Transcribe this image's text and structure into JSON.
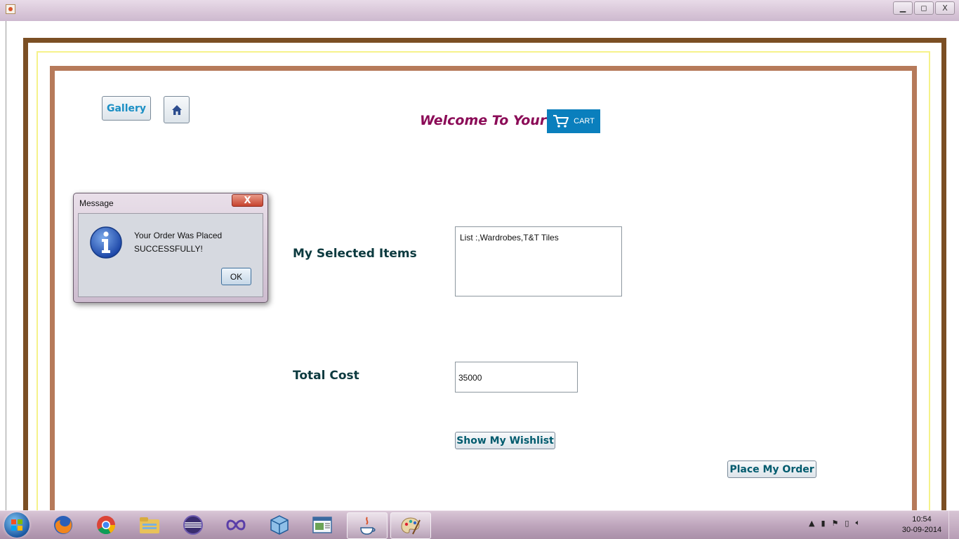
{
  "window": {
    "minimize": "▁",
    "maximize": "◻",
    "close": "X"
  },
  "toolbar": {
    "gallery_label": "Gallery",
    "home_icon": "home-icon"
  },
  "header": {
    "welcome": "Welcome To Your",
    "cart_label": "CART"
  },
  "form": {
    "items_label": "My Selected Items",
    "items_value": "List :,Wardrobes,T&T Tiles",
    "cost_label": "Total Cost",
    "cost_value": "35000",
    "wishlist_button": "Show My Wishlist",
    "place_order_button": "Place My Order"
  },
  "dialog": {
    "title": "Message",
    "close": "X",
    "line1": "Your Order Was Placed",
    "line2": "SUCCESSFULLY!",
    "ok": "OK"
  },
  "taskbar": {
    "apps": [
      "firefox-icon",
      "chrome-icon",
      "file-explorer-icon",
      "eclipse-icon",
      "visual-studio-icon",
      "virtualbox-icon",
      "window-app-icon",
      "java-icon",
      "paint-icon"
    ],
    "time": "10:54",
    "date": "30-09-2014"
  },
  "colors": {
    "outer_border": "#7b4f24",
    "mid_border": "#f6f28a",
    "inner_border": "#b67a5a",
    "welcome": "#8b0b57",
    "cart_bg": "#0a7fbd"
  }
}
